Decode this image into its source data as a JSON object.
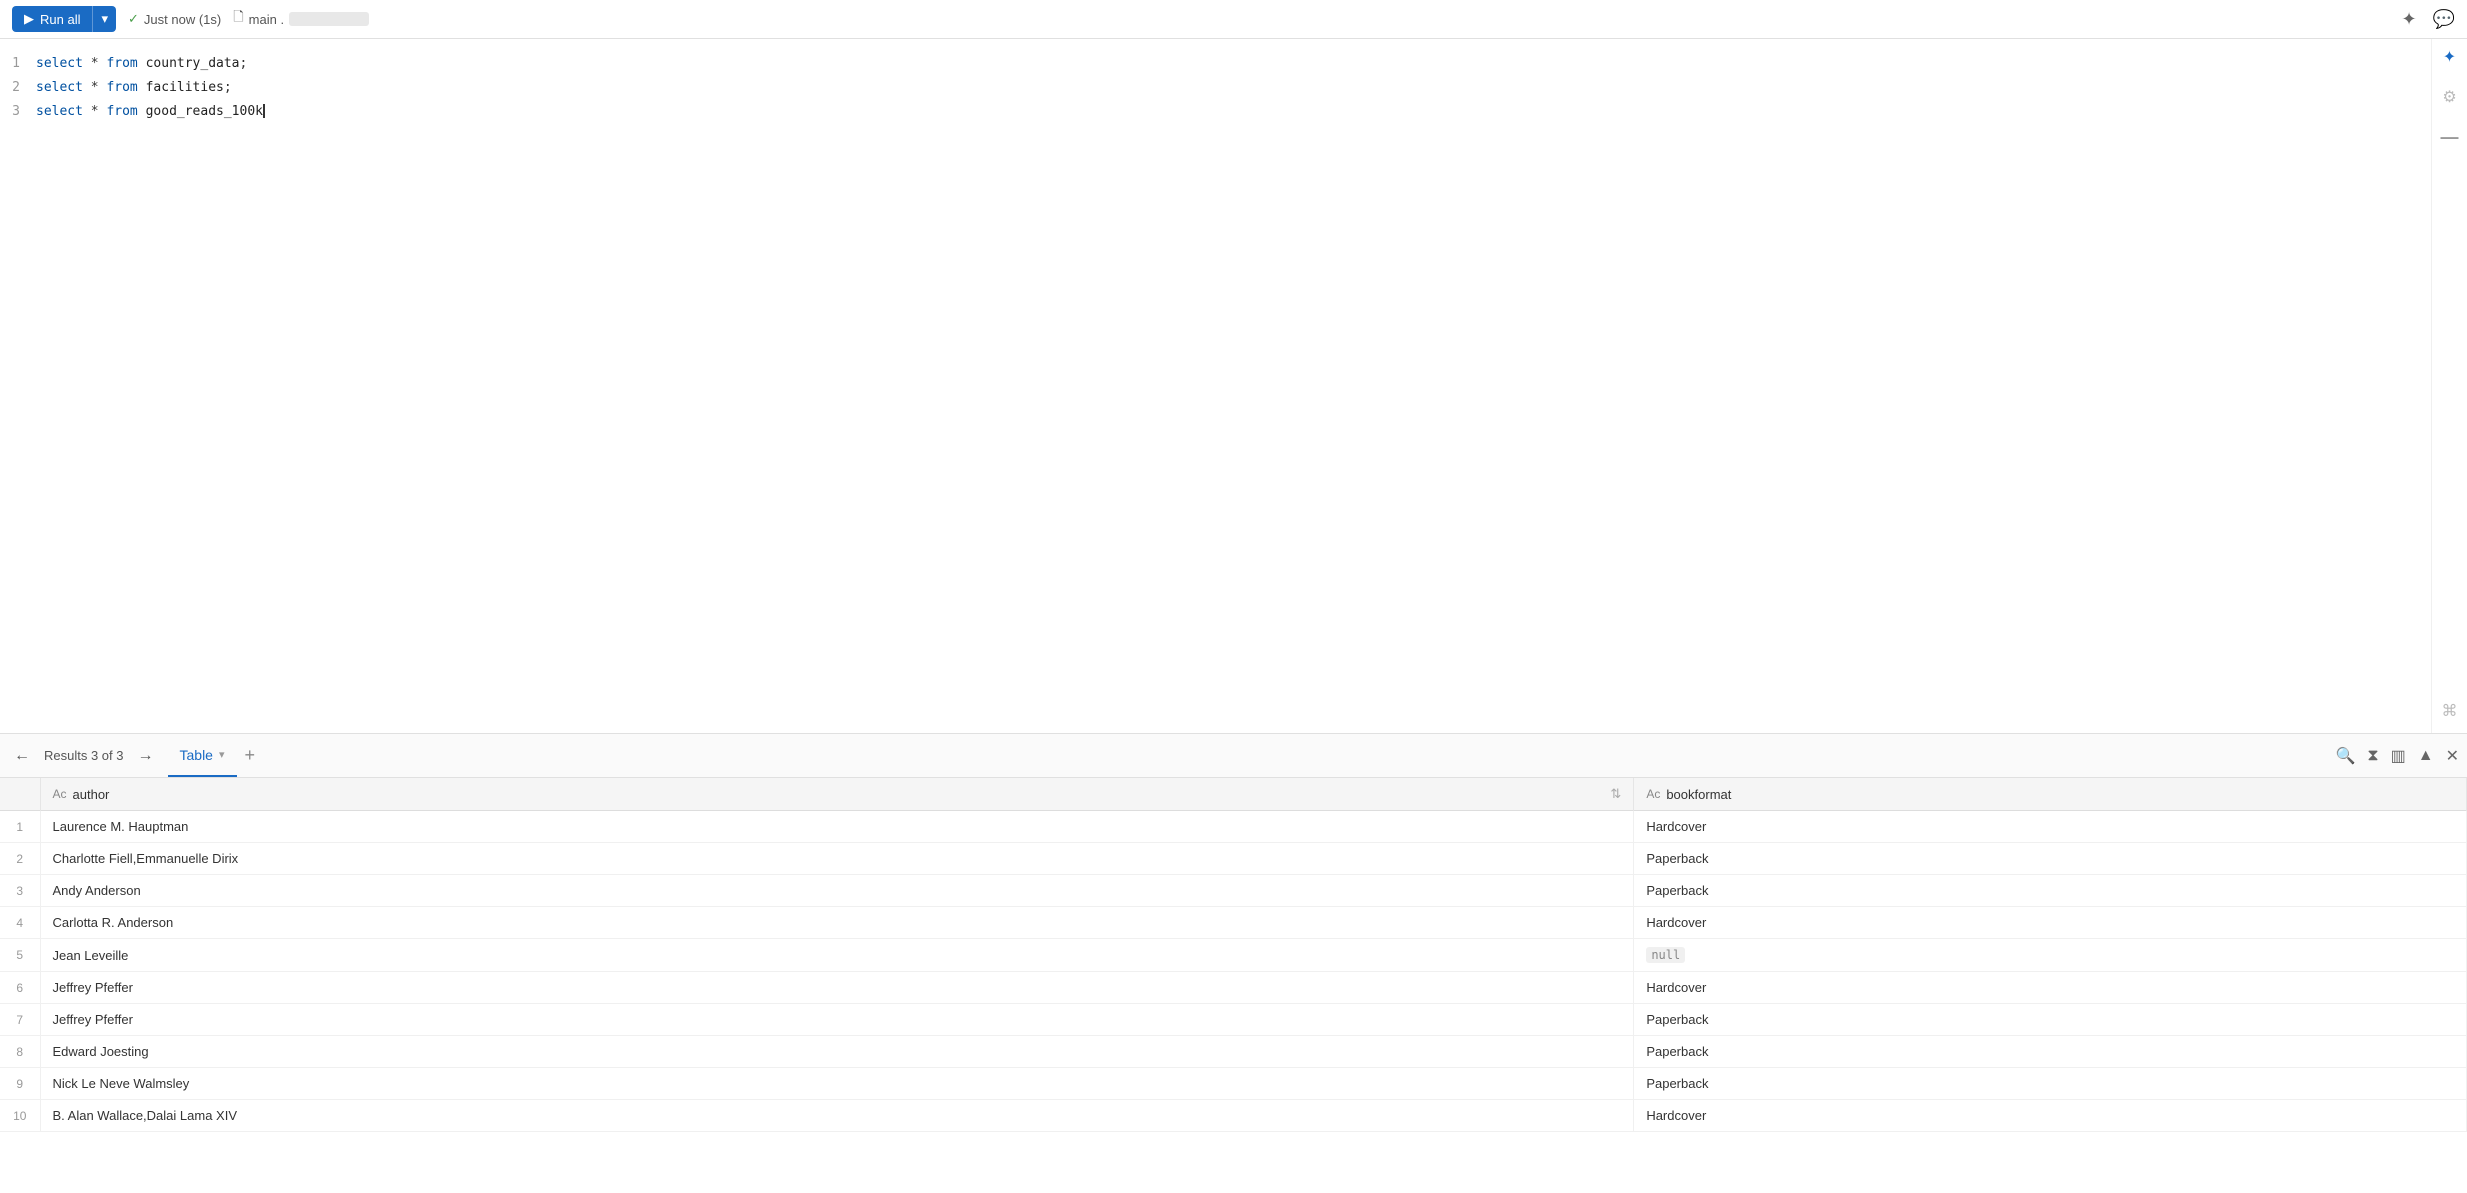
{
  "toolbar": {
    "run_all_label": "Run all",
    "status_label": "Just now (1s)",
    "db_label": "main .",
    "star_icon": "✦",
    "chat_icon": "💬",
    "shortcut_icon": "⌘"
  },
  "editor": {
    "lines": [
      {
        "number": "1",
        "text": "select * from country_data;"
      },
      {
        "number": "2",
        "text": "select * from facilities;"
      },
      {
        "number": "3",
        "text": "select * from good_reads_100k"
      }
    ]
  },
  "results": {
    "label": "Results 3 of 3",
    "tab_label": "Table",
    "add_tab_icon": "+",
    "columns": [
      {
        "name": "author",
        "type_icon": "Ac"
      },
      {
        "name": "bookformat",
        "type_icon": "Ac"
      }
    ],
    "rows": [
      {
        "num": "1",
        "author": "Laurence M. Hauptman",
        "bookformat": "Hardcover",
        "null": false
      },
      {
        "num": "2",
        "author": "Charlotte Fiell,Emmanuelle Dirix",
        "bookformat": "Paperback",
        "null": false
      },
      {
        "num": "3",
        "author": "Andy Anderson",
        "bookformat": "Paperback",
        "null": false
      },
      {
        "num": "4",
        "author": "Carlotta R. Anderson",
        "bookformat": "Hardcover",
        "null": false
      },
      {
        "num": "5",
        "author": "Jean Leveille",
        "bookformat": null,
        "null": true
      },
      {
        "num": "6",
        "author": "Jeffrey Pfeffer",
        "bookformat": "Hardcover",
        "null": false
      },
      {
        "num": "7",
        "author": "Jeffrey Pfeffer",
        "bookformat": "Paperback",
        "null": false
      },
      {
        "num": "8",
        "author": "Edward Joesting",
        "bookformat": "Paperback",
        "null": false
      },
      {
        "num": "9",
        "author": "Nick Le Neve Walmsley",
        "bookformat": "Paperback",
        "null": false
      },
      {
        "num": "10",
        "author": "B. Alan Wallace,Dalai Lama XIV",
        "bookformat": "Hardcover",
        "null": false
      }
    ]
  }
}
